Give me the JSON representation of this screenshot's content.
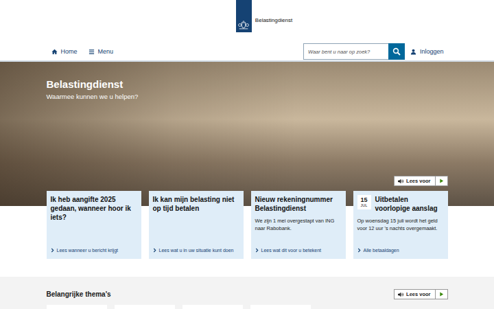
{
  "header": {
    "logo_text": "Belastingdienst"
  },
  "nav": {
    "items": [
      {
        "label": "Home"
      },
      {
        "label": "Menu"
      }
    ],
    "search": {
      "placeholder": "Waar bent u naar op zoek?"
    },
    "login": "Inloggen"
  },
  "hero": {
    "title": "Belastingdienst",
    "subtitle": "Waarmee kunnen we u helpen?",
    "read_aloud": "Lees voor"
  },
  "cards": [
    {
      "kind": "plain",
      "title": "Ik heb aangifte 2025 gedaan, wanneer hoor ik iets?",
      "body": "",
      "link": "Lees wanneer u bericht krijgt"
    },
    {
      "kind": "plain",
      "title": "Ik kan mijn belasting niet op tijd betalen",
      "body": "",
      "link": "Lees wat u in uw situatie kunt doen"
    },
    {
      "kind": "plain",
      "title": "Nieuw rekeningnummer Belastingdienst",
      "body": "We zijn 1 mei overgestapt van ING naar Rabobank.",
      "link": "Lees wat dit voor u betekent"
    },
    {
      "kind": "date",
      "day": "15",
      "month": "JUL",
      "title": "Uitbetalen voorlopige aanslag",
      "body": "Op woensdag 15 juli wordt het geld voor 12 uur 's nachts overgemaakt.",
      "link": "Alle betaaldagen"
    }
  ],
  "themes": {
    "title": "Belangrijke thema's",
    "read_aloud": "Lees voor"
  }
}
